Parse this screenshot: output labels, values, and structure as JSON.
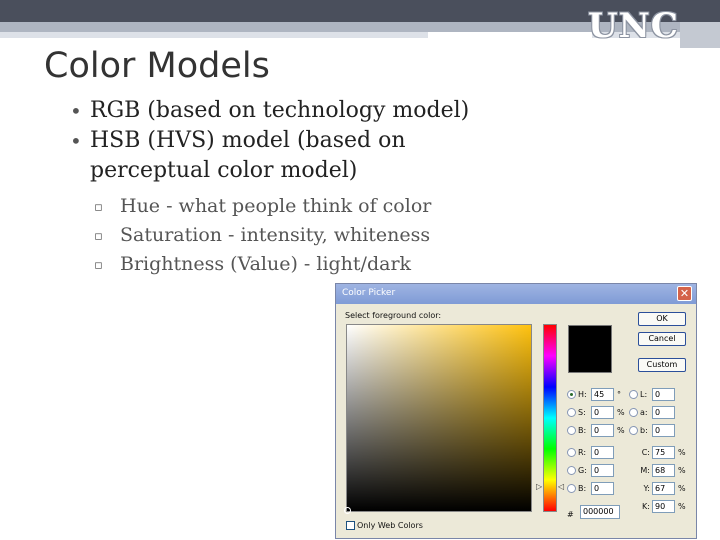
{
  "logo": "UNC",
  "slide": {
    "title": "Color Models",
    "bullets": [
      "RGB (based on technology model)",
      "HSB (HVS) model (based on",
      "perceptual color model)"
    ],
    "sub_bullets": [
      "Hue - what people think of color",
      "Saturation - intensity, whiteness",
      "Brightness (Value) - light/dark"
    ]
  },
  "dialog": {
    "title": "Color Picker",
    "close_glyph": "✕",
    "select_label": "Select foreground color:",
    "buttons": {
      "ok": "OK",
      "cancel": "Cancel",
      "custom": "Custom"
    },
    "hsb": [
      {
        "label": "H:",
        "value": "45",
        "unit": "°",
        "selected": true
      },
      {
        "label": "S:",
        "value": "0",
        "unit": "%",
        "selected": false
      },
      {
        "label": "B:",
        "value": "0",
        "unit": "%",
        "selected": false
      }
    ],
    "rgb": [
      {
        "label": "R:",
        "value": "0"
      },
      {
        "label": "G:",
        "value": "0"
      },
      {
        "label": "B:",
        "value": "0"
      }
    ],
    "lab": [
      {
        "label": "L:",
        "value": "0"
      },
      {
        "label": "a:",
        "value": "0"
      },
      {
        "label": "b:",
        "value": "0"
      }
    ],
    "cmyk": [
      {
        "label": "C:",
        "value": "75",
        "unit": "%"
      },
      {
        "label": "M:",
        "value": "68",
        "unit": "%"
      },
      {
        "label": "Y:",
        "value": "67",
        "unit": "%"
      },
      {
        "label": "K:",
        "value": "90",
        "unit": "%"
      }
    ],
    "hex_label": "#",
    "hex_value": "000000",
    "web_colors_label": "Only Web Colors",
    "current_color": "#000000",
    "hue_color": "#ffc20f"
  }
}
